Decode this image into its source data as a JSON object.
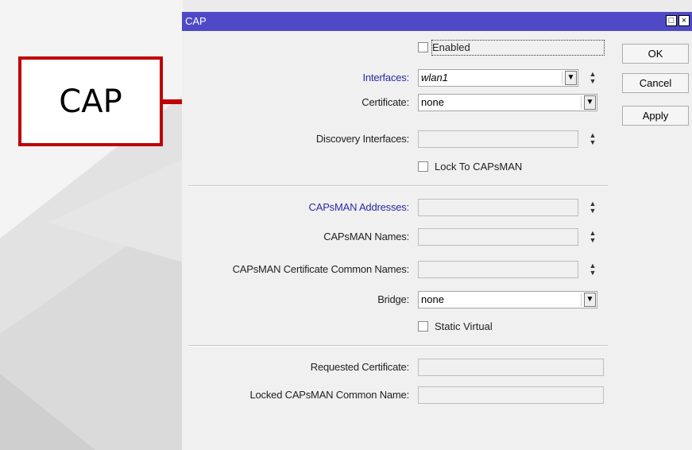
{
  "annotation": {
    "callout_label": "CAP"
  },
  "window": {
    "title": "CAP",
    "controls": {
      "maximize_icon": "maximize-icon",
      "close_icon": "close-icon",
      "close_glyph": "×",
      "maximize_glyph": "□"
    }
  },
  "form": {
    "enabled": {
      "label": "Enabled",
      "checked": false
    },
    "interfaces": {
      "label": "Interfaces:",
      "value": "wlan1"
    },
    "certificate": {
      "label": "Certificate:",
      "value": "none"
    },
    "discovery_interfaces": {
      "label": "Discovery Interfaces:",
      "value": ""
    },
    "lock_to_capsman": {
      "label": "Lock To CAPsMAN",
      "checked": false
    },
    "capsman_addresses": {
      "label": "CAPsMAN Addresses:",
      "value": ""
    },
    "capsman_names": {
      "label": "CAPsMAN Names:",
      "value": ""
    },
    "capsman_cert_common_names": {
      "label": "CAPsMAN Certificate Common Names:",
      "value": ""
    },
    "bridge": {
      "label": "Bridge:",
      "value": "none"
    },
    "static_virtual": {
      "label": "Static Virtual",
      "checked": false
    },
    "requested_certificate": {
      "label": "Requested Certificate:",
      "value": ""
    },
    "locked_capsman_common_name": {
      "label": "Locked CAPsMAN Common Name:",
      "value": ""
    }
  },
  "buttons": {
    "ok": "OK",
    "cancel": "Cancel",
    "apply": "Apply"
  },
  "colors": {
    "titlebar": "#4f49c8",
    "accent_label": "#2a2aa8",
    "callout_border": "#c00000",
    "arrow": "#c00000"
  }
}
